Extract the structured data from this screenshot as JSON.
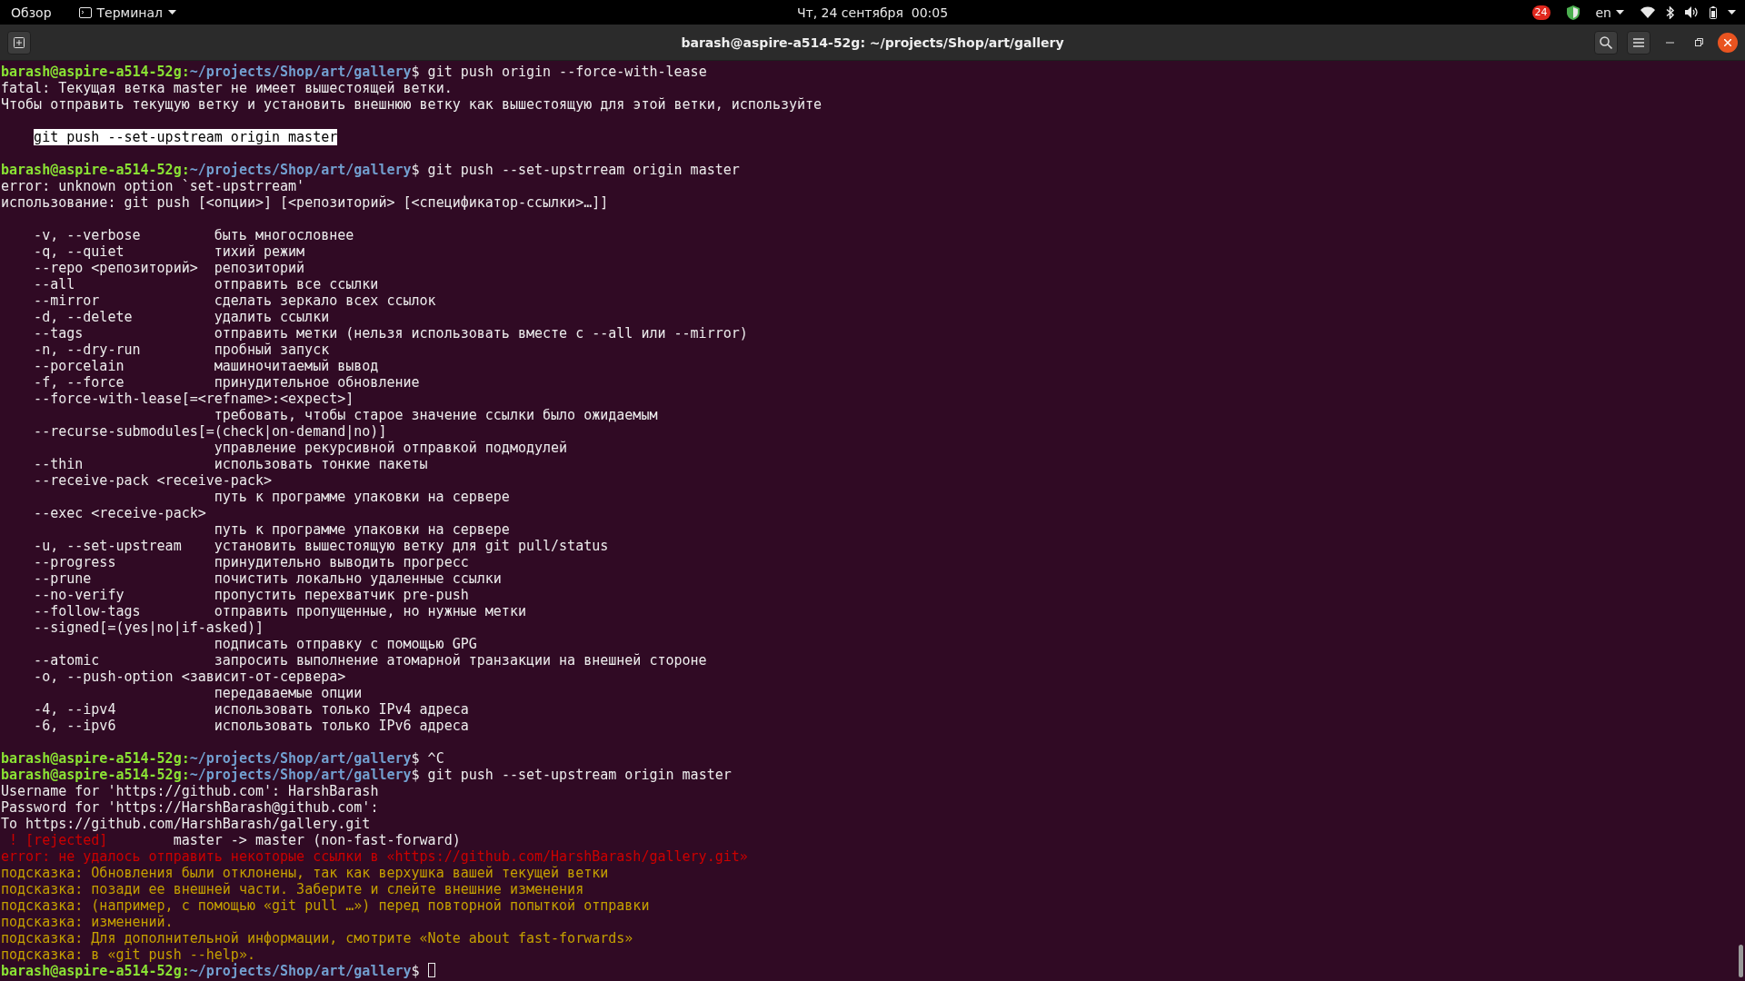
{
  "top_bar": {
    "activities": "Обзор",
    "app_menu": "Терминал",
    "clock": "Чт, 24 сентября  00:05",
    "notifications": "24",
    "keyboard_layout": "en"
  },
  "window": {
    "title": "barash@aspire-a514-52g: ~/projects/Shop/art/gallery"
  },
  "terminal": {
    "lines": [
      {
        "kind": "prompt",
        "user": "barash@aspire-a514-52g:",
        "path": "~/projects/Shop/art/gallery",
        "command": "$ git push origin --force-with-lease"
      },
      {
        "kind": "output",
        "text": "fatal: Текущая ветка master не имеет вышестоящей ветки."
      },
      {
        "kind": "output",
        "text": "Чтобы отправить текущую ветку и установить внешнюю ветку как вышестоящую для этой ветки, используйте"
      },
      {
        "kind": "blank"
      },
      {
        "kind": "highlight",
        "text": "git push --set-upstream origin master"
      },
      {
        "kind": "blank"
      },
      {
        "kind": "prompt",
        "user": "barash@aspire-a514-52g:",
        "path": "~/projects/Shop/art/gallery",
        "command": "$ git push --set-upstrream origin master"
      },
      {
        "kind": "output",
        "text": "error: unknown option `set-upstrream'"
      },
      {
        "kind": "output",
        "text": "использование: git push [<опции>] [<репозиторий> [<спецификатор-ссылки>…]]"
      },
      {
        "kind": "blank"
      },
      {
        "kind": "option",
        "flag": "-v, --verbose",
        "description": "быть многословнее"
      },
      {
        "kind": "option",
        "flag": "-q, --quiet",
        "description": "тихий режим"
      },
      {
        "kind": "option",
        "flag": "--repo <репозиторий>",
        "description": "репозиторий"
      },
      {
        "kind": "option",
        "flag": "--all",
        "description": "отправить все ссылки"
      },
      {
        "kind": "option",
        "flag": "--mirror",
        "description": "сделать зеркало всех ссылок"
      },
      {
        "kind": "option",
        "flag": "-d, --delete",
        "description": "удалить ссылки"
      },
      {
        "kind": "option",
        "flag": "--tags",
        "description": "отправить метки (нельзя использовать вместе с --all или --mirror)"
      },
      {
        "kind": "option",
        "flag": "-n, --dry-run",
        "description": "пробный запуск"
      },
      {
        "kind": "option",
        "flag": "--porcelain",
        "description": "машиночитаемый вывод"
      },
      {
        "kind": "option",
        "flag": "-f, --force",
        "description": "принудительное обновление"
      },
      {
        "kind": "option",
        "flag": "--force-with-lease[=<refname>:<expect>]"
      },
      {
        "kind": "option",
        "description": "требовать, чтобы старое значение ссылки было ожидаемым"
      },
      {
        "kind": "option",
        "flag": "--recurse-submodules[=(check|on-demand|no)]"
      },
      {
        "kind": "option",
        "description": "управление рекурсивной отправкой подмодулей"
      },
      {
        "kind": "option",
        "flag": "--thin",
        "description": "использовать тонкие пакеты"
      },
      {
        "kind": "option",
        "flag": "--receive-pack <receive-pack>"
      },
      {
        "kind": "option",
        "description": "путь к программе упаковки на сервере"
      },
      {
        "kind": "option",
        "flag": "--exec <receive-pack>"
      },
      {
        "kind": "option",
        "description": "путь к программе упаковки на сервере"
      },
      {
        "kind": "option",
        "flag": "-u, --set-upstream",
        "description": "установить вышестоящую ветку для git pull/status"
      },
      {
        "kind": "option",
        "flag": "--progress",
        "description": "принудительно выводить прогресс"
      },
      {
        "kind": "option",
        "flag": "--prune",
        "description": "почистить локально удаленные ссылки"
      },
      {
        "kind": "option",
        "flag": "--no-verify",
        "description": "пропустить перехватчик pre-push"
      },
      {
        "kind": "option",
        "flag": "--follow-tags",
        "description": "отправить пропущенные, но нужные метки"
      },
      {
        "kind": "option",
        "flag": "--signed[=(yes|no|if-asked)]"
      },
      {
        "kind": "option",
        "description": "подписать отправку с помощью GPG"
      },
      {
        "kind": "option",
        "flag": "--atomic",
        "description": "запросить выполнение атомарной транзакции на внешней стороне"
      },
      {
        "kind": "option",
        "flag": "-o, --push-option <зависит-от-сервера>"
      },
      {
        "kind": "option",
        "description": "передаваемые опции"
      },
      {
        "kind": "option",
        "flag": "-4, --ipv4",
        "description": "использовать только IPv4 адреса"
      },
      {
        "kind": "option",
        "flag": "-6, --ipv6",
        "description": "использовать только IPv6 адреса"
      },
      {
        "kind": "blank"
      },
      {
        "kind": "prompt",
        "user": "barash@aspire-a514-52g:",
        "path": "~/projects/Shop/art/gallery",
        "command": "$ ^C"
      },
      {
        "kind": "prompt",
        "user": "barash@aspire-a514-52g:",
        "path": "~/projects/Shop/art/gallery",
        "command": "$ git push --set-upstream origin master"
      },
      {
        "kind": "output",
        "text": "Username for 'https://github.com': HarshBarash"
      },
      {
        "kind": "output",
        "text": "Password for 'https://HarshBarash@github.com':"
      },
      {
        "kind": "output",
        "text": "To https://github.com/HarshBarash/gallery.git"
      },
      {
        "kind": "rejected",
        "mark": "! [rejected]",
        "text": "master -> master (non-fast-forward)"
      },
      {
        "kind": "error",
        "text": "error: не удалось отправить некоторые ссылки в «https://github.com/HarshBarash/gallery.git»"
      },
      {
        "kind": "hint",
        "text": "подсказка: Обновления были отклонены, так как верхушка вашей текущей ветки"
      },
      {
        "kind": "hint",
        "text": "подсказка: позади ее внешней части. Заберите и слейте внешние изменения"
      },
      {
        "kind": "hint",
        "text": "подсказка: (например, с помощью «git pull …») перед повторной попыткой отправки"
      },
      {
        "kind": "hint",
        "text": "подсказка: изменений."
      },
      {
        "kind": "hint",
        "text": "подсказка: Для дополнительной информации, смотрите «Note about fast-forwards»"
      },
      {
        "kind": "hint",
        "text": "подсказка: в «git push --help»."
      },
      {
        "kind": "prompt",
        "user": "barash@aspire-a514-52g:",
        "path": "~/projects/Shop/art/gallery",
        "command": "$",
        "cursor": true
      }
    ]
  }
}
